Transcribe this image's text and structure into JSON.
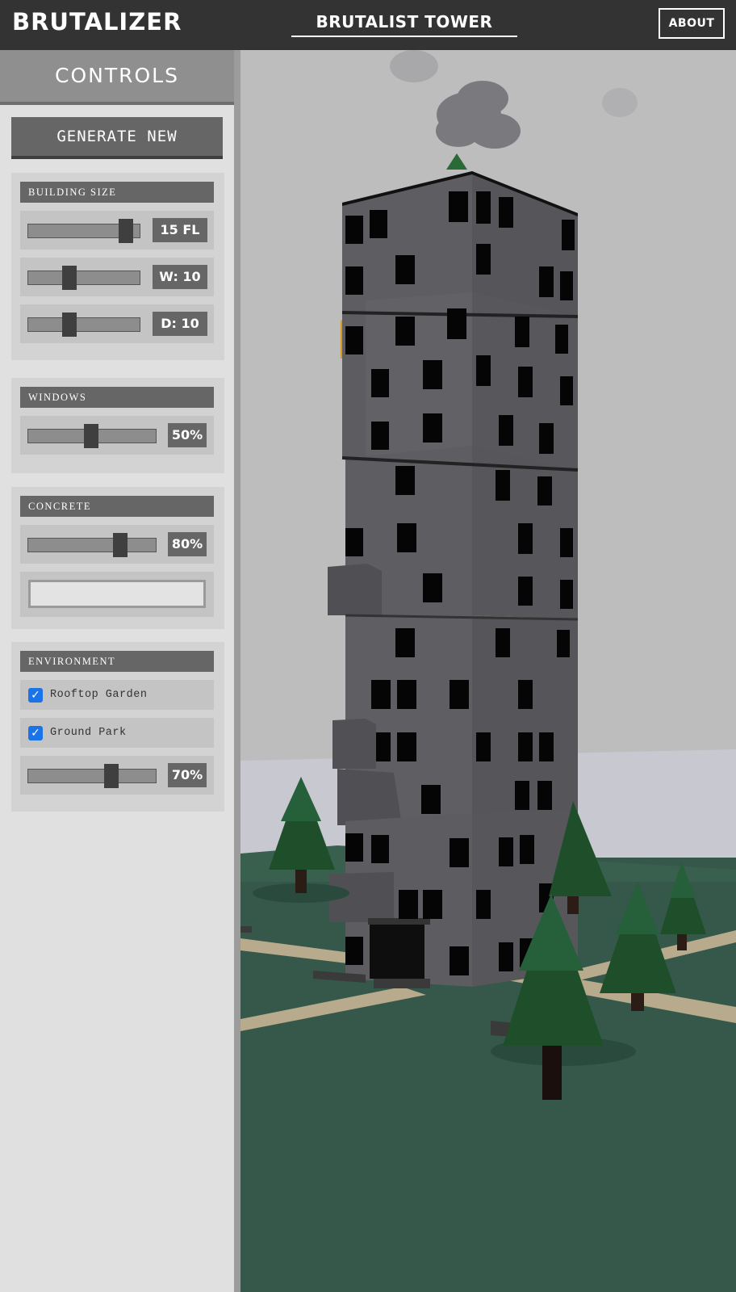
{
  "header": {
    "brand": "BRUTALIZER",
    "title": "BRUTALIST TOWER",
    "about_label": "ABOUT"
  },
  "sidebar": {
    "title": "CONTROLS",
    "generate_label": "GENERATE NEW",
    "building_size": {
      "title": "BUILDING SIZE",
      "floors": {
        "label": "15 FL",
        "value": 15,
        "fraction": 0.87
      },
      "width": {
        "label": "W: 10",
        "value": 10,
        "fraction": 0.37
      },
      "depth": {
        "label": "D: 10",
        "value": 10,
        "fraction": 0.37
      }
    },
    "windows": {
      "title": "WINDOWS",
      "density": {
        "label": "50%",
        "value": 50
      }
    },
    "concrete": {
      "title": "CONCRETE",
      "amount": {
        "label": "80%",
        "value": 80
      },
      "color_value": "#e3e3e3"
    },
    "environment": {
      "title": "ENVIRONMENT",
      "rooftop_garden": {
        "label": "Rooftop Garden",
        "checked": true
      },
      "ground_park": {
        "label": "Ground Park",
        "checked": true
      },
      "density": {
        "label": "70%",
        "value": 70
      }
    }
  },
  "colors": {
    "header_bg": "#333333",
    "sidebar_bg": "#e0e0e0",
    "panel_bg": "#d3d3d3",
    "accent_checkbox": "#1a73e8",
    "sky": "#bdbdbd",
    "ground": "#35584a",
    "path": "#b8aa8c",
    "concrete": "#5f5f63",
    "tree": "#1f4f2a"
  }
}
